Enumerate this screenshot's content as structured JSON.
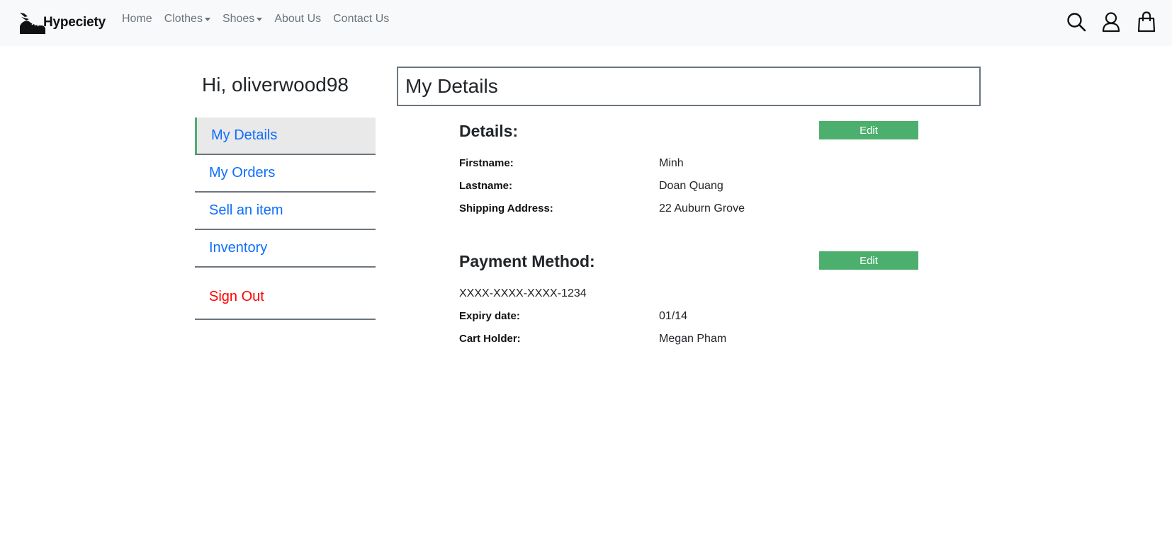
{
  "nav": {
    "brand": "Hypeciety",
    "links": [
      "Home",
      "Clothes",
      "Shoes",
      "About Us",
      "Contact Us"
    ]
  },
  "sidebar": {
    "greeting": "Hi, oliverwood98",
    "items": [
      "My Details",
      "My Orders",
      "Sell an item",
      "Inventory"
    ],
    "signout": "Sign Out"
  },
  "main": {
    "title": "My Details",
    "details": {
      "heading": "Details:",
      "edit_label": "Edit",
      "rows": [
        {
          "label": "Firstname:",
          "value": "Minh"
        },
        {
          "label": "Lastname:",
          "value": "Doan Quang"
        },
        {
          "label": "Shipping Address:",
          "value": "22 Auburn Grove"
        }
      ]
    },
    "payment": {
      "heading": "Payment Method:",
      "edit_label": "Edit",
      "card_number": "XXXX-XXXX-XXXX-1234",
      "rows": [
        {
          "label": "Expiry date:",
          "value": "01/14"
        },
        {
          "label": "Cart Holder:",
          "value": "Megan Pham"
        }
      ]
    }
  },
  "colors": {
    "accent_green": "#4caf6e",
    "link_blue": "#0d6efd",
    "signout_red": "#ff0000",
    "nav_bg": "#f8f9fa"
  },
  "icons": [
    "sneaker-logo-icon",
    "search-icon",
    "user-icon",
    "shopping-bag-icon"
  ]
}
